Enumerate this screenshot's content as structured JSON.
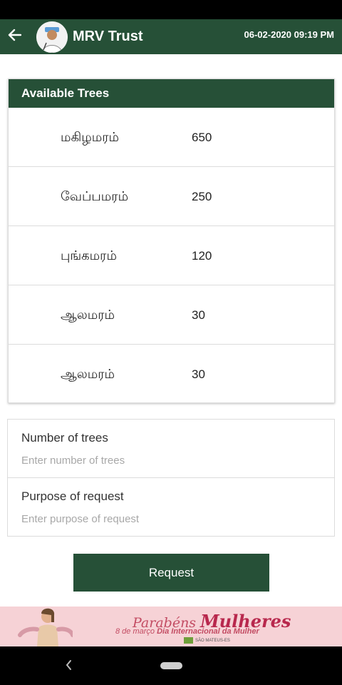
{
  "app_bar": {
    "title": "MRV Trust",
    "datetime": "06-02-2020 09:19 PM",
    "back_icon": "arrow-left-icon",
    "avatar": "profile-avatar"
  },
  "available_trees": {
    "header": "Available Trees",
    "rows": [
      {
        "name": "மகிழமரம்",
        "count": "650"
      },
      {
        "name": "வேப்பமரம்",
        "count": "250"
      },
      {
        "name": "புங்கமரம்",
        "count": "120"
      },
      {
        "name": "ஆலமரம்",
        "count": "30"
      },
      {
        "name": "ஆலமரம்",
        "count": "30"
      }
    ]
  },
  "form": {
    "trees_label": "Number of trees",
    "trees_placeholder": "Enter number of trees",
    "purpose_label": "Purpose of request",
    "purpose_placeholder": "Enter purpose of request"
  },
  "request_button": "Request",
  "banner": {
    "title_prefix": "Parabéns",
    "title_main": "Mulheres",
    "subtitle_date": "8 de março",
    "subtitle_event": "Dia Internacional da Mulher",
    "logo_text": "SÃO MATEUS-ES"
  },
  "colors": {
    "primary": "#265037",
    "banner_bg": "#f6d2d6",
    "banner_text": "#c34c63"
  }
}
